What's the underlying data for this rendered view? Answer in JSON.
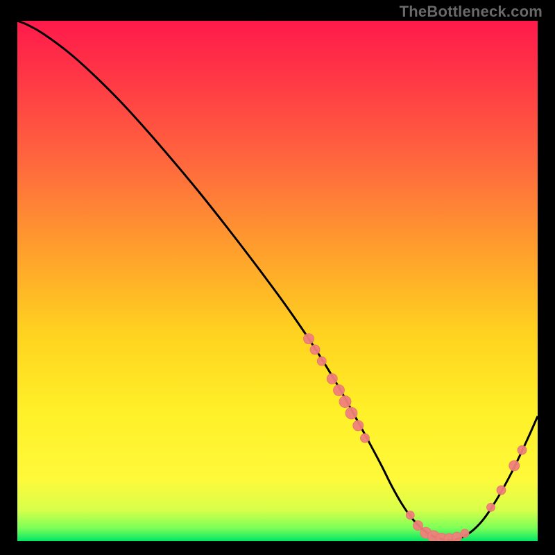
{
  "attribution": "TheBottleneck.com",
  "colors": {
    "curve": "#000000",
    "marker_fill": "#ef7f7b",
    "marker_stroke": "#e9726e",
    "gradient_top": "#ff1a4b",
    "gradient_mid_upper": "#ff6a3d",
    "gradient_mid": "#ffd21f",
    "gradient_mid_lower": "#fff93a",
    "gradient_bottom": "#00e765",
    "frame_bg": "#000000"
  },
  "chart_data": {
    "type": "line",
    "title": "",
    "xlabel": "",
    "ylabel": "",
    "xlim": [
      0,
      100
    ],
    "ylim": [
      0,
      100
    ],
    "curve": {
      "x": [
        0,
        2,
        5,
        10,
        15,
        20,
        25,
        30,
        35,
        40,
        45,
        50,
        53,
        56,
        59,
        62,
        65,
        67.5,
        70,
        72,
        74,
        76,
        78,
        80,
        83,
        86,
        89,
        92,
        95,
        98,
        100
      ],
      "y": [
        100,
        99.2,
        97.5,
        93.8,
        89.3,
        84.3,
        78.8,
        73.0,
        67.0,
        60.7,
        54.2,
        47.5,
        43.3,
        38.9,
        34.2,
        29.2,
        23.8,
        19.2,
        14.5,
        10.5,
        7.0,
        4.2,
        2.2,
        0.9,
        0.2,
        1.0,
        3.5,
        7.8,
        13.2,
        19.5,
        24.0
      ]
    },
    "gradient_stops": [
      {
        "offset": 0.0,
        "color": "#ff1a4b"
      },
      {
        "offset": 0.12,
        "color": "#ff3a45"
      },
      {
        "offset": 0.28,
        "color": "#ff6a3d"
      },
      {
        "offset": 0.45,
        "color": "#ffa22c"
      },
      {
        "offset": 0.6,
        "color": "#ffd21f"
      },
      {
        "offset": 0.75,
        "color": "#fff028"
      },
      {
        "offset": 0.88,
        "color": "#fff93a"
      },
      {
        "offset": 0.94,
        "color": "#d8ff4a"
      },
      {
        "offset": 0.975,
        "color": "#7cff58"
      },
      {
        "offset": 1.0,
        "color": "#00e765"
      }
    ],
    "markers": {
      "cluster_left": [
        {
          "x": 56,
          "y": 38.9,
          "r": 7.5
        },
        {
          "x": 57.2,
          "y": 36.8,
          "r": 7.0
        },
        {
          "x": 58.5,
          "y": 34.6,
          "r": 6.5
        },
        {
          "x": 60.5,
          "y": 31.2,
          "r": 7.5
        },
        {
          "x": 61.8,
          "y": 29.0,
          "r": 8.0
        },
        {
          "x": 63.0,
          "y": 26.8,
          "r": 8.5
        },
        {
          "x": 64.2,
          "y": 24.6,
          "r": 8.5
        },
        {
          "x": 65.5,
          "y": 22.2,
          "r": 7.5
        },
        {
          "x": 66.8,
          "y": 19.8,
          "r": 6.5
        }
      ],
      "cluster_valley": [
        {
          "x": 75.5,
          "y": 5.0,
          "r": 6.0
        },
        {
          "x": 77.0,
          "y": 3.0,
          "r": 7.0
        },
        {
          "x": 78.5,
          "y": 1.6,
          "r": 8.0
        },
        {
          "x": 80.0,
          "y": 0.9,
          "r": 8.5
        },
        {
          "x": 81.5,
          "y": 0.5,
          "r": 8.0
        },
        {
          "x": 83.0,
          "y": 0.5,
          "r": 7.5
        },
        {
          "x": 84.5,
          "y": 0.8,
          "r": 7.0
        },
        {
          "x": 86.0,
          "y": 1.5,
          "r": 6.0
        }
      ],
      "cluster_right": [
        {
          "x": 91.0,
          "y": 6.5,
          "r": 6.0
        },
        {
          "x": 93.0,
          "y": 9.8,
          "r": 6.5
        },
        {
          "x": 95.5,
          "y": 14.5,
          "r": 7.5
        },
        {
          "x": 97.0,
          "y": 17.5,
          "r": 6.5
        }
      ]
    }
  }
}
